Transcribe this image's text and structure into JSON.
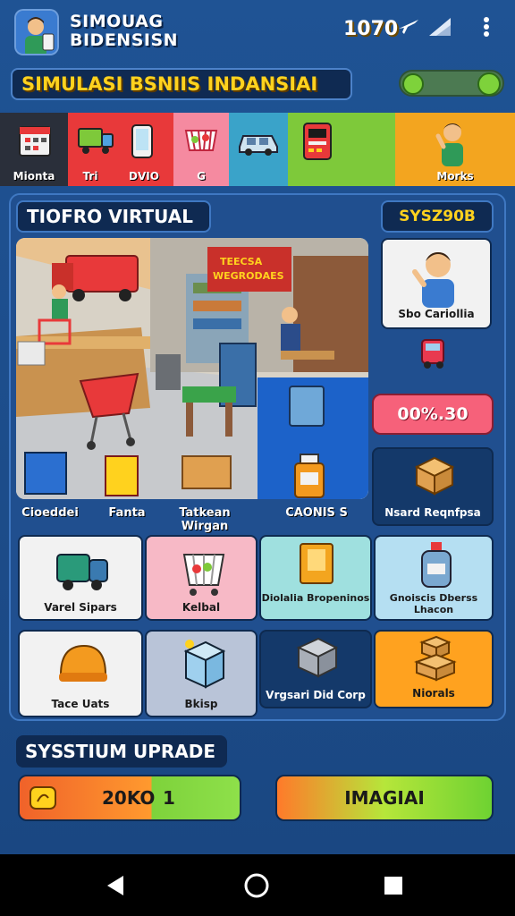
{
  "header": {
    "title_line1": "SIMOUAG",
    "title_line2": "BIDENSISN",
    "banner": "SIMULASI BSNIIS INDANSIAI",
    "icons": [
      "airplane-icon",
      "building-icon",
      "menu-dots-icon"
    ]
  },
  "categories": [
    {
      "label": "Mionta",
      "color": "#2a2f3a",
      "icon": "calendar-icon"
    },
    {
      "label": "Tri",
      "color": "#e8393a",
      "icon": "truck-icon"
    },
    {
      "label": "DVIO",
      "color": "#e8393a",
      "icon": "phone-icon"
    },
    {
      "label": "G",
      "color": "#f58aa0",
      "icon": "basket-icon"
    },
    {
      "label": "",
      "color": "#3aa3c9",
      "icon": "car-icon"
    },
    {
      "label": "",
      "color": "#7ec93a",
      "icon": "atm-icon"
    },
    {
      "label": "Morks",
      "color": "#f3a51f",
      "icon": "person-icon"
    }
  ],
  "category_value": "1070",
  "main": {
    "title": "TIOFRO VIRTUAL",
    "score": "SYSZ90B",
    "scene_sign": "TEECSA WEGRODAES",
    "pill": "00%.30",
    "profile_label": "Sbo Cariollia",
    "scene_labels": [
      "Cioeddei",
      "Fanta",
      "Tatkean Wirgan"
    ],
    "side_labels": [
      "CAONIS S",
      "Nsard Reqnfpsa"
    ],
    "grid": [
      {
        "label": "Varel Sipars",
        "icon": "van-icon",
        "bg": "#f2f2f2"
      },
      {
        "label": "Kelbal",
        "icon": "cart-icon",
        "bg": "#f7b9c6"
      },
      {
        "label": "Diolalia Bropeninos",
        "icon": "folder-icon",
        "bg": "#9fe0df"
      },
      {
        "label": "Gnoiscis Dberss Lhacon",
        "icon": "bottle-icon",
        "bg": "#b5dff2"
      },
      {
        "label": "Tace Uats",
        "icon": "helmet-icon",
        "bg": "#f2f2f2"
      },
      {
        "label": "Bkisp",
        "icon": "box-icon",
        "bg": "#b9c4d8"
      },
      {
        "label": "Vrgsari Did Corp",
        "icon": "crate-icon",
        "bg": "#14396a"
      },
      {
        "label": "Niorals",
        "icon": "boxes-icon",
        "bg": "#ffa21f"
      }
    ]
  },
  "upgrade": {
    "title": "SYSSTIUM UPRADE",
    "progress_value": "20KO",
    "progress_level": "1",
    "button": "IMAGIAI"
  },
  "nav": [
    "back-icon",
    "home-icon",
    "recents-icon"
  ]
}
